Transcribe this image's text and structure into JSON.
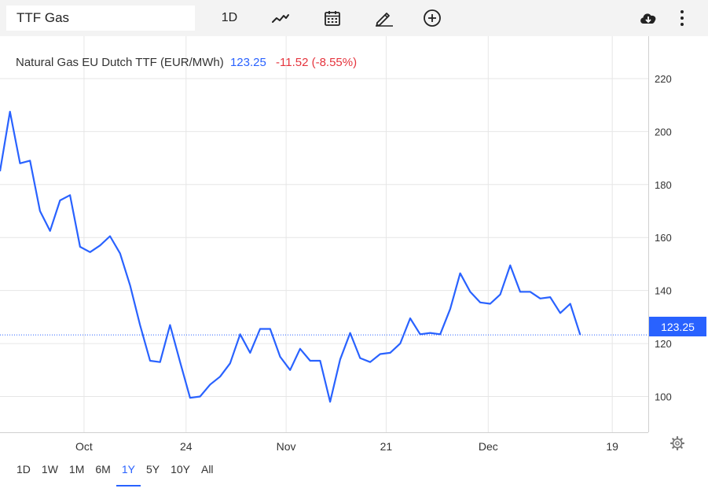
{
  "toolbar": {
    "symbol_value": "TTF Gas",
    "interval_label": "1D"
  },
  "legend": {
    "name": "Natural Gas EU Dutch TTF (EUR/MWh)",
    "last": "123.25",
    "change": "-11.52 (-8.55%)"
  },
  "price_tag": "123.25",
  "ranges": [
    "1D",
    "1W",
    "1M",
    "6M",
    "1Y",
    "5Y",
    "10Y",
    "All"
  ],
  "active_range": "1Y",
  "colors": {
    "line": "#2962ff",
    "negative": "#e5343d",
    "toolbar": "#f3f3f3"
  },
  "chart_data": {
    "type": "line",
    "title": "Natural Gas EU Dutch TTF (EUR/MWh)",
    "ylim": [
      86.5,
      236
    ],
    "yticks": [
      100,
      120,
      140,
      160,
      180,
      200,
      220
    ],
    "grid": true,
    "x_tick_labels": [
      {
        "label": "Oct",
        "x": 4.2
      },
      {
        "label": "24",
        "x": 9.3
      },
      {
        "label": "Nov",
        "x": 14.3
      },
      {
        "label": "21",
        "x": 19.3
      },
      {
        "label": "Dec",
        "x": 24.4
      },
      {
        "label": "19",
        "x": 30.6
      }
    ],
    "last_value": 123.25,
    "series": [
      {
        "name": "",
        "x": [
          0,
          0.5,
          1,
          1.5,
          2,
          2.5,
          3,
          3.5,
          4,
          4.5,
          5,
          5.5,
          6,
          6.5,
          7,
          7.5,
          8,
          8.5,
          9,
          9.5,
          10,
          10.5,
          11,
          11.5,
          12,
          12.5,
          13,
          13.5,
          14,
          14.5,
          15,
          15.5,
          16,
          16.5,
          17,
          17.5,
          18,
          18.5,
          19,
          19.5,
          20,
          20.5,
          21,
          21.5,
          22,
          22.5,
          23,
          23.5,
          24,
          24.5,
          25,
          25.5,
          26,
          26.5,
          27,
          27.5,
          28,
          28.5,
          29
        ],
        "values": [
          185,
          207.5,
          188,
          189,
          170,
          162.5,
          174,
          176,
          156.5,
          154.5,
          157,
          160.5,
          154,
          142,
          127,
          113.5,
          113,
          127,
          113,
          99.5,
          100,
          104.5,
          107.5,
          112.5,
          123.5,
          116.5,
          125.5,
          125.5,
          115,
          110,
          118,
          113.5,
          113.5,
          98,
          114,
          124,
          114.5,
          113,
          116,
          116.5,
          120,
          129.5,
          123.5,
          124,
          123.5,
          133,
          146.5,
          139.5,
          135.5,
          135,
          138.5,
          149.5,
          139.5,
          139.5,
          137,
          137.5,
          131.5,
          135,
          123.25
        ]
      }
    ]
  }
}
